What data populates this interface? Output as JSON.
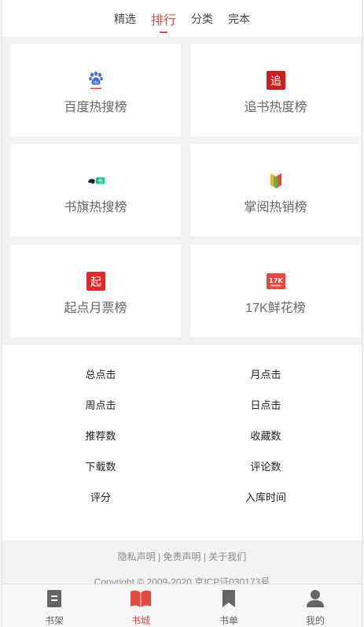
{
  "tabs": [
    "精选",
    "排行",
    "分类",
    "完本"
  ],
  "active_tab": "排行",
  "accent_color": "#e8473c",
  "rankings": [
    {
      "label": "百度热搜榜",
      "icon": "baidu-paw-icon"
    },
    {
      "label": "追书热度榜",
      "icon": "zhuishu-icon"
    },
    {
      "label": "书旗热搜榜",
      "icon": "shuqi-icon"
    },
    {
      "label": "掌阅热销榜",
      "icon": "zhangyue-icon"
    },
    {
      "label": "起点月票榜",
      "icon": "qidian-icon"
    },
    {
      "label": "17K鲜花榜",
      "icon": "17k-icon"
    }
  ],
  "icon_text": {
    "zhuishu": "追",
    "qidian": "起",
    "k17": "17K"
  },
  "sorts": [
    "总点击",
    "月点击",
    "周点击",
    "日点击",
    "推荐数",
    "收藏数",
    "下载数",
    "评论数",
    "评分",
    "入库时间"
  ],
  "footer": {
    "privacy": "隐私声明",
    "sep1": " | ",
    "disclaimer": "免责声明",
    "sep2": " | ",
    "about": "关于我们",
    "copyright": "Copyright © 2009-2020 京ICP证030173号"
  },
  "bottom_nav": [
    {
      "label": "书架",
      "icon": "bookshelf-icon"
    },
    {
      "label": "书城",
      "icon": "open-book-icon"
    },
    {
      "label": "书单",
      "icon": "bookmark-icon"
    },
    {
      "label": "我的",
      "icon": "user-icon"
    }
  ],
  "active_nav": "书城"
}
